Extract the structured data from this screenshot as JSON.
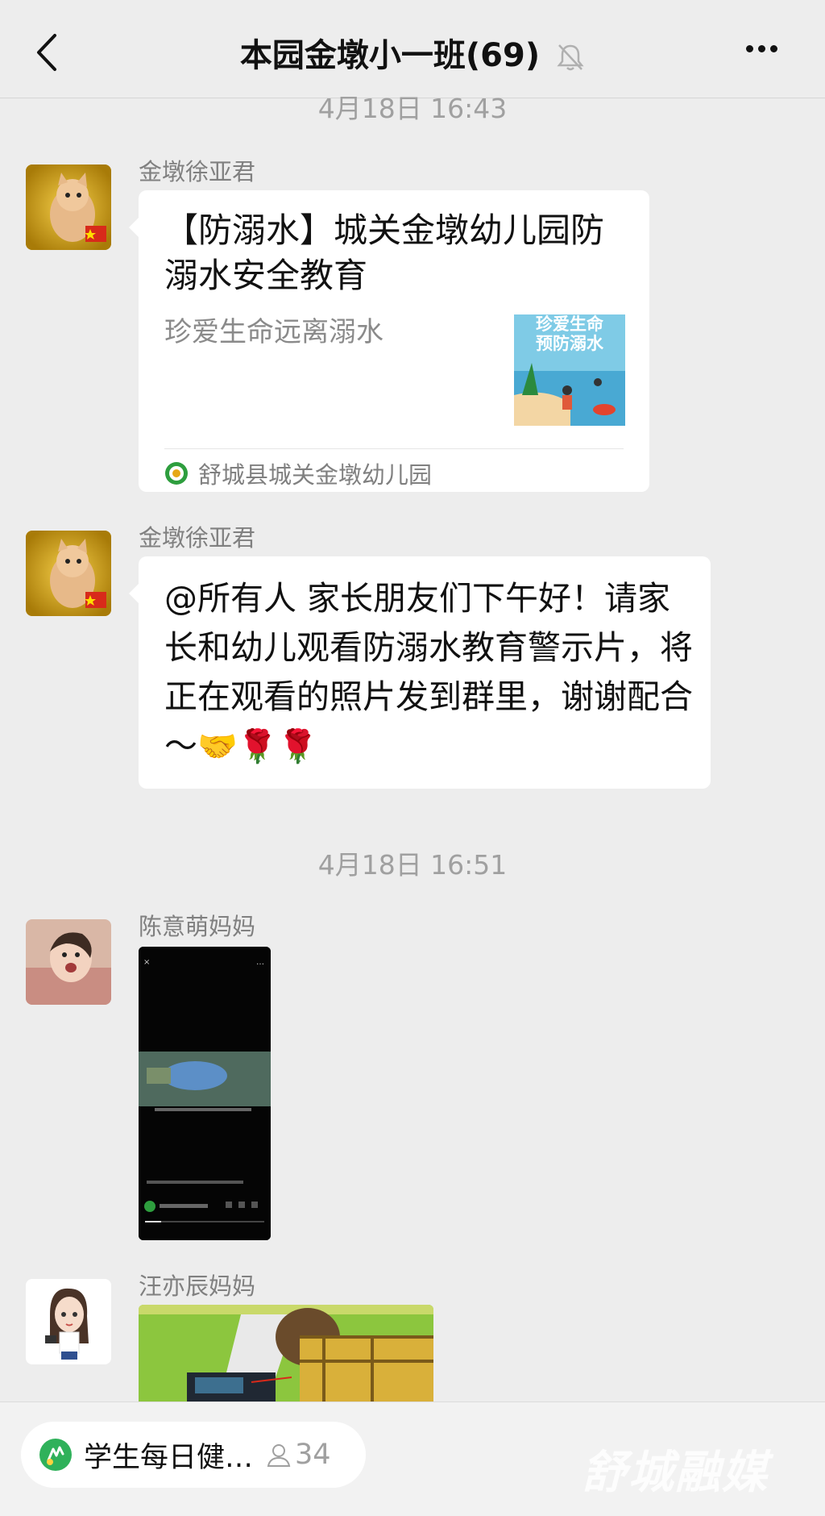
{
  "header": {
    "title": "本园金墩小一班(69)"
  },
  "messages": {
    "time1": "4月18日 16:43",
    "msg1": {
      "sender": "金墩徐亚君",
      "card_title": "【防溺水】城关金墩幼儿园防溺水安全教育",
      "card_desc": "珍爱生命远离溺水",
      "thumb_text_1": "珍爱生命",
      "thumb_text_2": "预防溺水",
      "card_source": "舒城县城关金墩幼儿园"
    },
    "msg2": {
      "sender": "金墩徐亚君",
      "text": "@所有人 家长朋友们下午好！请家长和幼儿观看防溺水教育警示片，将正在观看的照片发到群里，谢谢配合～",
      "emojis": "🤝🌹🌹"
    },
    "time2": "4月18日 16:51",
    "msg3": {
      "sender": "陈意萌妈妈"
    },
    "msg4": {
      "sender": "汪亦辰妈妈"
    }
  },
  "bottom_bar": {
    "mini_program_label": "学生每日健…",
    "count": "34",
    "watermark": "舒城融媒"
  },
  "colors": {
    "background": "#ededed",
    "bubble": "#ffffff",
    "accent_green": "#07c160"
  },
  "icons": [
    "back-arrow-icon",
    "mute-bell-icon",
    "more-dots-icon",
    "user-icon",
    "mini-program-icon"
  ]
}
